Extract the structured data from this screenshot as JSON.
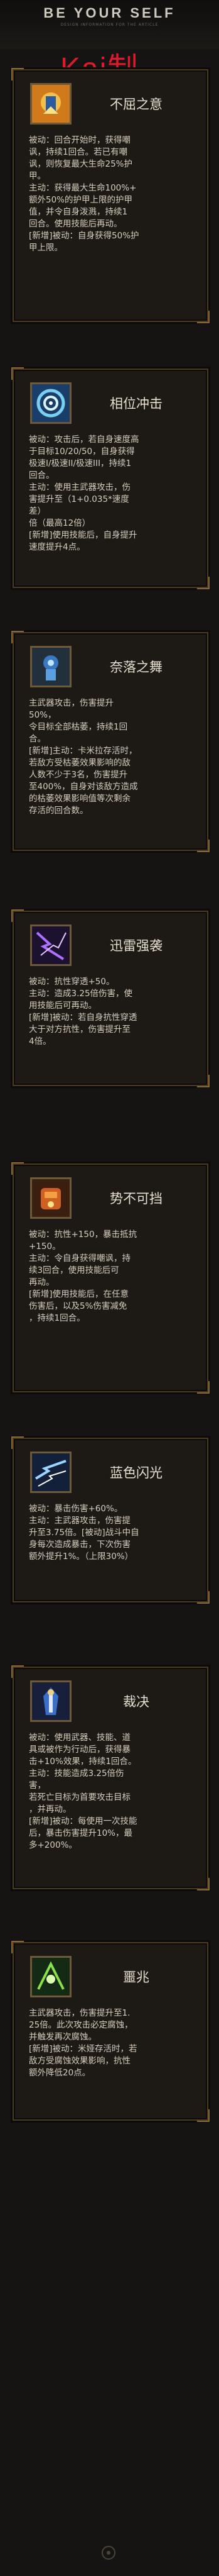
{
  "header": {
    "title": "BE YOUR SELF",
    "subtitle": "DESIGN INFORMATION FOR THE ARTICLE",
    "watermark": "Kai制"
  },
  "cards": [
    {
      "name": "不屈之意",
      "icon": "warrior-icon",
      "lines": [
        "被动：回合开始时，获得嘲",
        "讽，持续1回合。若已有嘲",
        "讽，则恢复最大生命25%护",
        "甲。",
        "主动：获得最大生命100%+",
        "额外50%的护甲上限的护甲",
        "值，并令自身泼溅，持续1",
        "回合。使用技能后再动。",
        "[新增]被动：自身获得50%护",
        "甲上限。"
      ]
    },
    {
      "name": "相位冲击",
      "icon": "vortex-icon",
      "lines": [
        "被动：攻击后，若自身速度高",
        "于目标10/20/50，自身获得",
        "极速I/极速II/极速III，持续1",
        "回合。",
        "主动：使用主武器攻击，伤",
        "害提升至（1+0.035*速度差）",
        "倍（最高12倍）",
        "[新增]使用技能后，自身提升",
        "速度提升4点。"
      ]
    },
    {
      "name": "奈落之舞",
      "icon": "dancer-icon",
      "lines": [
        "主武器攻击，伤害提升50%，",
        "令目标全部枯萎，持续1回",
        "合。",
        "[新增]主动：卡米拉存活时，",
        "若敌方受枯萎效果影响的敌",
        "人数不少于3名，伤害提升",
        "至400%，自身对该敌方造成",
        "的枯萎效果影响值等次剩余",
        "存活的回合数。"
      ]
    },
    {
      "name": "迅雷强袭",
      "icon": "lightning-icon",
      "lines": [
        "被动：抗性穿透+50。",
        "主动：造成3.25倍伤害，使",
        "用技能后可再动。",
        "[新增]被动：若自身抗性穿透",
        "大于对方抗性，伤害提升至",
        "4倍。"
      ]
    },
    {
      "name": "势不可挡",
      "icon": "armor-icon",
      "lines": [
        "被动：抗性+150，暴击抵抗",
        "+150。",
        "主动：令自身获得嘲讽，持",
        "续3回合，使用技能后可",
        "再动。",
        "[新增]使用技能后，在任意",
        "伤害后，以及5%伤害减免",
        "，持续1回合。"
      ]
    },
    {
      "name": "蓝色闪光",
      "icon": "flash-icon",
      "lines": [
        "被动：暴击伤害+60%。",
        "主动：主武器攻击，伤害提",
        "升至3.75倍。[被动]战斗中自",
        "身每次造成暴击，下次伤害",
        "额外提升1%。（上限30%）"
      ]
    },
    {
      "name": "裁决",
      "icon": "knight-icon",
      "lines": [
        "被动：使用武器、技能、道",
        "具或被作为行动后，获得暴",
        "击+10%效果，持续1回合。",
        "主动：技能造成3.25倍伤害，",
        "若死亡目标为首要攻击目标",
        "，并再动。",
        "[新增]被动：每使用一次技能",
        "后，暴击伤害提升10%，最",
        "多+200%。"
      ]
    },
    {
      "name": "噩兆",
      "icon": "omen-icon",
      "lines": [
        "主武器攻击，伤害提升至1.",
        "25倍。此次攻击必定腐蚀，",
        "并触发再次腐蚀。",
        "[新增]被动：米娅存活时，若",
        "敌方受腐蚀效果影响，抗性",
        "额外降低20点。"
      ]
    }
  ]
}
